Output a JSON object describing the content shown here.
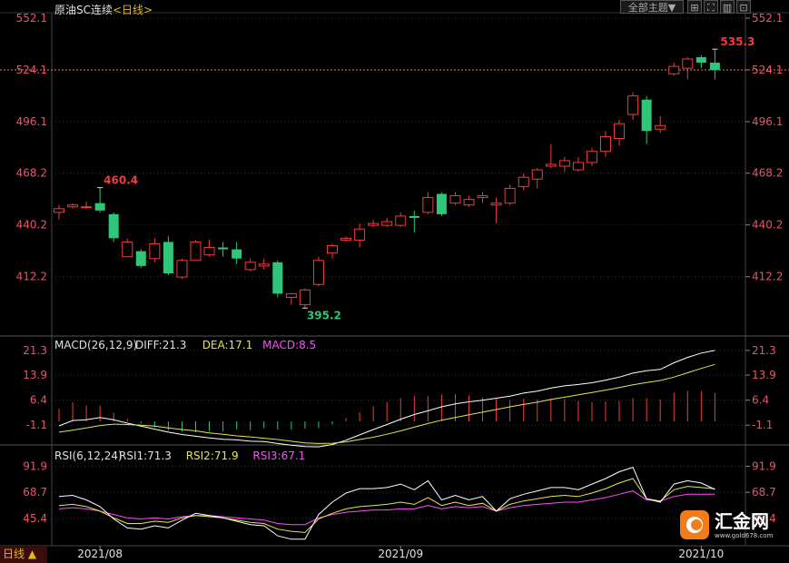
{
  "header": {
    "symbol": "原油SC连续",
    "period": "<日线>",
    "theme_button": "全部主题▼"
  },
  "toolbar": {
    "icons": [
      "grid-icon",
      "fullscreen-icon",
      "chart-type-icon",
      "settings-icon"
    ]
  },
  "bottom": {
    "period_button": "日线 ▲",
    "dates": [
      "2021/08",
      "2021/09",
      "2021/10"
    ]
  },
  "logo": {
    "name": "汇金网",
    "url": "www.gold678.com"
  },
  "colors": {
    "up": "#f23b3b",
    "down": "#30c67a",
    "axis_text": "#e8556a",
    "grid": "#333333",
    "ref_line": "#e8785a",
    "diff": "#ffffff",
    "dea": "#e6e64a",
    "macd": "#ff4cff",
    "rsi1": "#ffffff",
    "rsi2": "#e6e64a",
    "rsi3": "#ff4cff"
  },
  "chart_data": [
    {
      "type": "candlestick",
      "y_ticks": [
        "552.1",
        "524.1",
        "496.1",
        "468.2",
        "440.2",
        "412.2"
      ],
      "ylim": [
        377.4,
        552.1
      ],
      "reference_line": 524.1,
      "annotations": {
        "high": "460.4",
        "low": "395.2",
        "last_high": "535.3"
      },
      "candles": [
        {
          "o": 447,
          "h": 451,
          "l": 443,
          "c": 449
        },
        {
          "o": 450,
          "h": 452,
          "l": 449,
          "c": 451
        },
        {
          "o": 450,
          "h": 453,
          "l": 449,
          "c": 450
        },
        {
          "o": 452,
          "h": 460.4,
          "l": 447,
          "c": 448
        },
        {
          "o": 446,
          "h": 447,
          "l": 431,
          "c": 433
        },
        {
          "o": 423,
          "h": 433,
          "l": 423,
          "c": 431
        },
        {
          "o": 426,
          "h": 427,
          "l": 417,
          "c": 418
        },
        {
          "o": 422,
          "h": 433,
          "l": 420,
          "c": 430
        },
        {
          "o": 431,
          "h": 434,
          "l": 413,
          "c": 414
        },
        {
          "o": 412,
          "h": 422,
          "l": 411,
          "c": 421
        },
        {
          "o": 421,
          "h": 432,
          "l": 421,
          "c": 431
        },
        {
          "o": 424,
          "h": 432,
          "l": 423,
          "c": 428
        },
        {
          "o": 428,
          "h": 431,
          "l": 423,
          "c": 427
        },
        {
          "o": 427,
          "h": 431,
          "l": 419,
          "c": 422
        },
        {
          "o": 416,
          "h": 422,
          "l": 415,
          "c": 420
        },
        {
          "o": 418,
          "h": 422,
          "l": 416,
          "c": 419
        },
        {
          "o": 420,
          "h": 421,
          "l": 401,
          "c": 403
        },
        {
          "o": 401,
          "h": 403,
          "l": 397,
          "c": 403
        },
        {
          "o": 397,
          "h": 406,
          "l": 395.2,
          "c": 405
        },
        {
          "o": 408,
          "h": 423,
          "l": 407,
          "c": 421
        },
        {
          "o": 425,
          "h": 430,
          "l": 422,
          "c": 429
        },
        {
          "o": 432,
          "h": 434,
          "l": 431,
          "c": 433
        },
        {
          "o": 432,
          "h": 441,
          "l": 428,
          "c": 438
        },
        {
          "o": 440,
          "h": 443,
          "l": 439,
          "c": 441
        },
        {
          "o": 440,
          "h": 444,
          "l": 439,
          "c": 442
        },
        {
          "o": 440,
          "h": 447,
          "l": 439,
          "c": 445
        },
        {
          "o": 445,
          "h": 448,
          "l": 436,
          "c": 444
        },
        {
          "o": 447,
          "h": 458,
          "l": 446,
          "c": 455
        },
        {
          "o": 457,
          "h": 458,
          "l": 445,
          "c": 446
        },
        {
          "o": 452,
          "h": 458,
          "l": 451,
          "c": 456
        },
        {
          "o": 451,
          "h": 456,
          "l": 450,
          "c": 454
        },
        {
          "o": 455,
          "h": 458,
          "l": 452,
          "c": 456
        },
        {
          "o": 451,
          "h": 455,
          "l": 441,
          "c": 452
        },
        {
          "o": 452,
          "h": 462,
          "l": 451,
          "c": 460
        },
        {
          "o": 461,
          "h": 468,
          "l": 459,
          "c": 466
        },
        {
          "o": 465,
          "h": 471,
          "l": 460,
          "c": 470
        },
        {
          "o": 472,
          "h": 484,
          "l": 471,
          "c": 473
        },
        {
          "o": 472,
          "h": 477,
          "l": 469,
          "c": 475
        },
        {
          "o": 470,
          "h": 477,
          "l": 469,
          "c": 474
        },
        {
          "o": 474,
          "h": 482,
          "l": 472,
          "c": 480
        },
        {
          "o": 480,
          "h": 491,
          "l": 477,
          "c": 488
        },
        {
          "o": 487,
          "h": 497,
          "l": 483,
          "c": 495
        },
        {
          "o": 500,
          "h": 512,
          "l": 497,
          "c": 510
        },
        {
          "o": 508,
          "h": 510,
          "l": 484,
          "c": 491
        },
        {
          "o": 492,
          "h": 499,
          "l": 490,
          "c": 494
        },
        {
          "o": 522,
          "h": 528,
          "l": 521,
          "c": 526
        },
        {
          "o": 525,
          "h": 531,
          "l": 519,
          "c": 530
        },
        {
          "o": 531,
          "h": 532,
          "l": 525,
          "c": 528
        },
        {
          "o": 528,
          "h": 535.3,
          "l": 519,
          "c": 524
        }
      ]
    },
    {
      "type": "line",
      "title": "MACD(26,12,9)",
      "legend": [
        {
          "label": "DIFF:21.3",
          "color": "#ffffff"
        },
        {
          "label": "DEA:17.1",
          "color": "#e6e64a"
        },
        {
          "label": "MACD:8.5",
          "color": "#ff4cff"
        }
      ],
      "y_ticks": [
        "21.3",
        "13.9",
        "6.4",
        "-1.1"
      ],
      "ylim": [
        -9.2,
        24.4
      ],
      "series": [
        {
          "name": "DIFF",
          "values": [
            -1.3,
            0.3,
            0.5,
            1.2,
            0.5,
            -0.5,
            -1.4,
            -2.3,
            -3.2,
            -3.9,
            -4.4,
            -4.9,
            -5.3,
            -5.5,
            -5.9,
            -6.0,
            -6.6,
            -7.1,
            -7.5,
            -7.6,
            -6.9,
            -5.6,
            -4.0,
            -2.4,
            -0.9,
            0.7,
            2.1,
            3.2,
            4.4,
            5.3,
            5.9,
            6.4,
            7.0,
            7.6,
            8.5,
            9.1,
            10.0,
            10.7,
            11.1,
            11.6,
            12.4,
            13.3,
            14.5,
            15.2,
            15.6,
            17.6,
            19.2,
            20.5,
            21.3
          ]
        },
        {
          "name": "DEA",
          "values": [
            -3.2,
            -2.6,
            -1.9,
            -1.2,
            -0.8,
            -0.9,
            -1.1,
            -1.4,
            -1.9,
            -2.4,
            -2.8,
            -3.4,
            -3.8,
            -4.3,
            -4.6,
            -5.0,
            -5.4,
            -5.9,
            -6.4,
            -6.6,
            -6.5,
            -6.1,
            -5.4,
            -4.7,
            -3.8,
            -2.8,
            -1.7,
            -0.6,
            0.4,
            1.2,
            2.0,
            2.8,
            3.6,
            4.4,
            5.1,
            5.8,
            6.6,
            7.3,
            8.0,
            8.7,
            9.4,
            10.2,
            11.0,
            11.7,
            12.3,
            13.3,
            14.6,
            15.9,
            17.1
          ]
        },
        {
          "name": "MACD",
          "values": [
            3.8,
            5.8,
            4.8,
            4.8,
            2.6,
            0.8,
            -0.6,
            -1.8,
            -2.6,
            -3.0,
            -3.2,
            -3.0,
            -3.0,
            -2.4,
            -2.6,
            -2.0,
            -2.4,
            -2.4,
            -2.2,
            -2.0,
            -0.8,
            1.0,
            2.8,
            4.6,
            5.8,
            7.0,
            7.6,
            7.6,
            8.0,
            8.2,
            7.8,
            7.2,
            6.8,
            6.4,
            6.8,
            6.6,
            6.8,
            6.8,
            6.2,
            5.8,
            6.0,
            6.2,
            7.0,
            7.0,
            6.6,
            8.6,
            9.2,
            9.2,
            8.5
          ]
        }
      ]
    },
    {
      "type": "line",
      "title": "RSI(6,12,24)",
      "legend": [
        {
          "label": "RSI1:71.3",
          "color": "#ffffff"
        },
        {
          "label": "RSI2:71.9",
          "color": "#e6e64a"
        },
        {
          "label": "RSI3:67.1",
          "color": "#ff4cff"
        }
      ],
      "y_ticks": [
        "91.9",
        "68.7",
        "45.4"
      ],
      "ylim": [
        22.0,
        106.0
      ],
      "series": [
        {
          "name": "RSI1",
          "values": [
            65,
            66,
            62,
            56,
            45,
            37,
            36,
            39,
            37,
            44,
            50,
            48,
            46,
            43,
            40,
            39,
            30,
            27,
            27,
            49,
            60,
            68,
            72,
            72,
            73,
            76,
            71,
            79,
            62,
            66,
            62,
            65,
            52,
            63,
            67,
            70,
            73,
            73,
            71,
            76,
            81,
            87,
            91,
            63,
            60,
            76,
            79,
            77,
            71.3
          ]
        },
        {
          "name": "RSI2",
          "values": [
            57,
            58,
            56,
            52,
            46,
            41,
            41,
            43,
            42,
            46,
            48,
            47,
            46,
            44,
            42,
            41,
            36,
            34,
            33,
            45,
            50,
            54,
            56,
            57,
            58,
            60,
            58,
            64,
            57,
            60,
            57,
            59,
            52,
            58,
            61,
            63,
            65,
            66,
            65,
            68,
            72,
            77,
            81,
            63,
            61,
            71,
            74,
            73,
            71.9
          ]
        },
        {
          "name": "RSI3",
          "values": [
            54,
            55,
            54,
            52,
            49,
            46,
            45,
            46,
            45,
            47,
            48,
            48,
            47,
            46,
            45,
            44,
            41,
            40,
            40,
            46,
            49,
            51,
            52,
            53,
            53,
            54,
            54,
            57,
            54,
            56,
            55,
            56,
            52,
            55,
            57,
            58,
            59,
            60,
            60,
            62,
            64,
            67,
            70,
            62,
            61,
            65,
            67,
            67,
            67.1
          ]
        }
      ]
    }
  ]
}
